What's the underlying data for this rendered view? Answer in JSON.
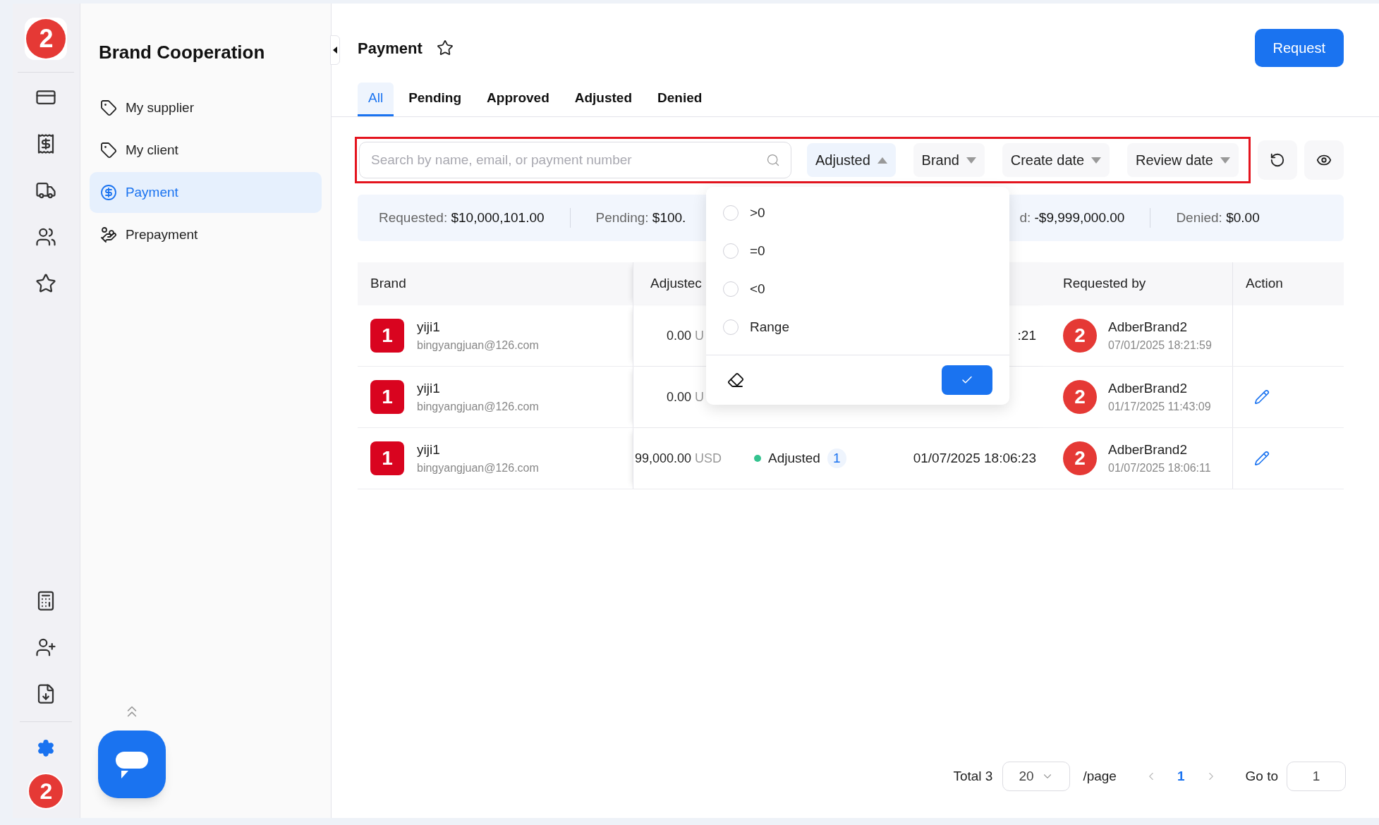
{
  "rail": {
    "logo": "2",
    "settings": {
      "selected": true
    },
    "avatar": "2"
  },
  "sidebar": {
    "title": "Brand Cooperation",
    "items": [
      {
        "label": "My supplier",
        "selected": false
      },
      {
        "label": "My client",
        "selected": false
      },
      {
        "label": "Payment",
        "selected": true
      },
      {
        "label": "Prepayment",
        "selected": false
      }
    ]
  },
  "header": {
    "title": "Payment",
    "starred": false,
    "button": "Request"
  },
  "tabs": [
    {
      "label": "All",
      "selected": true
    },
    {
      "label": "Pending",
      "selected": false
    },
    {
      "label": "Approved",
      "selected": false
    },
    {
      "label": "Adjusted",
      "selected": false
    },
    {
      "label": "Denied",
      "selected": false
    }
  ],
  "search": {
    "placeholder": "Search by name, email, or payment number"
  },
  "filters": [
    {
      "label": "Adjusted",
      "expanded": true
    },
    {
      "label": "Brand",
      "expanded": false
    },
    {
      "label": "Create date",
      "expanded": false
    },
    {
      "label": "Review date",
      "expanded": false
    }
  ],
  "summary": [
    {
      "label": "Requested:",
      "value": "$10,000,101.00"
    },
    {
      "label": "Pending:",
      "value": "$100."
    },
    {
      "label": "d:",
      "value": "-$9,999,000.00"
    },
    {
      "label": "Denied:",
      "value": "$0.00"
    }
  ],
  "table": {
    "columns": [
      "Brand",
      "Adjustec",
      "Requested by",
      "Action"
    ],
    "rows": [
      {
        "brand_mark": "1",
        "name": "yiji1",
        "email": "bingyangjuan@126.com",
        "amount": "0.00",
        "currency": "U",
        "status": null,
        "status_count": null,
        "date": ":21",
        "requester_mark": "2",
        "requester": "AdberBrand2",
        "requested_at": "07/01/2025 18:21:59",
        "editable": false
      },
      {
        "brand_mark": "1",
        "name": "yiji1",
        "email": "bingyangjuan@126.com",
        "amount": "0.00",
        "currency": "U",
        "status": null,
        "status_count": null,
        "date": null,
        "requester_mark": "2",
        "requester": "AdberBrand2",
        "requested_at": "01/17/2025 11:43:09",
        "editable": true
      },
      {
        "brand_mark": "1",
        "name": "yiji1",
        "email": "bingyangjuan@126.com",
        "amount": "99,000.00",
        "currency": "USD",
        "status": "Adjusted",
        "status_count": "1",
        "date": "01/07/2025 18:06:23",
        "requester_mark": "2",
        "requester": "AdberBrand2",
        "requested_at": "01/07/2025 18:06:11",
        "editable": true
      }
    ]
  },
  "dropdown": {
    "options": [
      {
        "label": ">0",
        "selected": false
      },
      {
        "label": "=0",
        "selected": false
      },
      {
        "label": "<0",
        "selected": false
      },
      {
        "label": "Range",
        "selected": false
      }
    ]
  },
  "pagination": {
    "total": "Total 3",
    "page_size": "20",
    "per_page": "/page",
    "pages": [
      {
        "label": "1",
        "selected": true
      }
    ],
    "goto_label": "Go to",
    "goto_value": "1"
  }
}
